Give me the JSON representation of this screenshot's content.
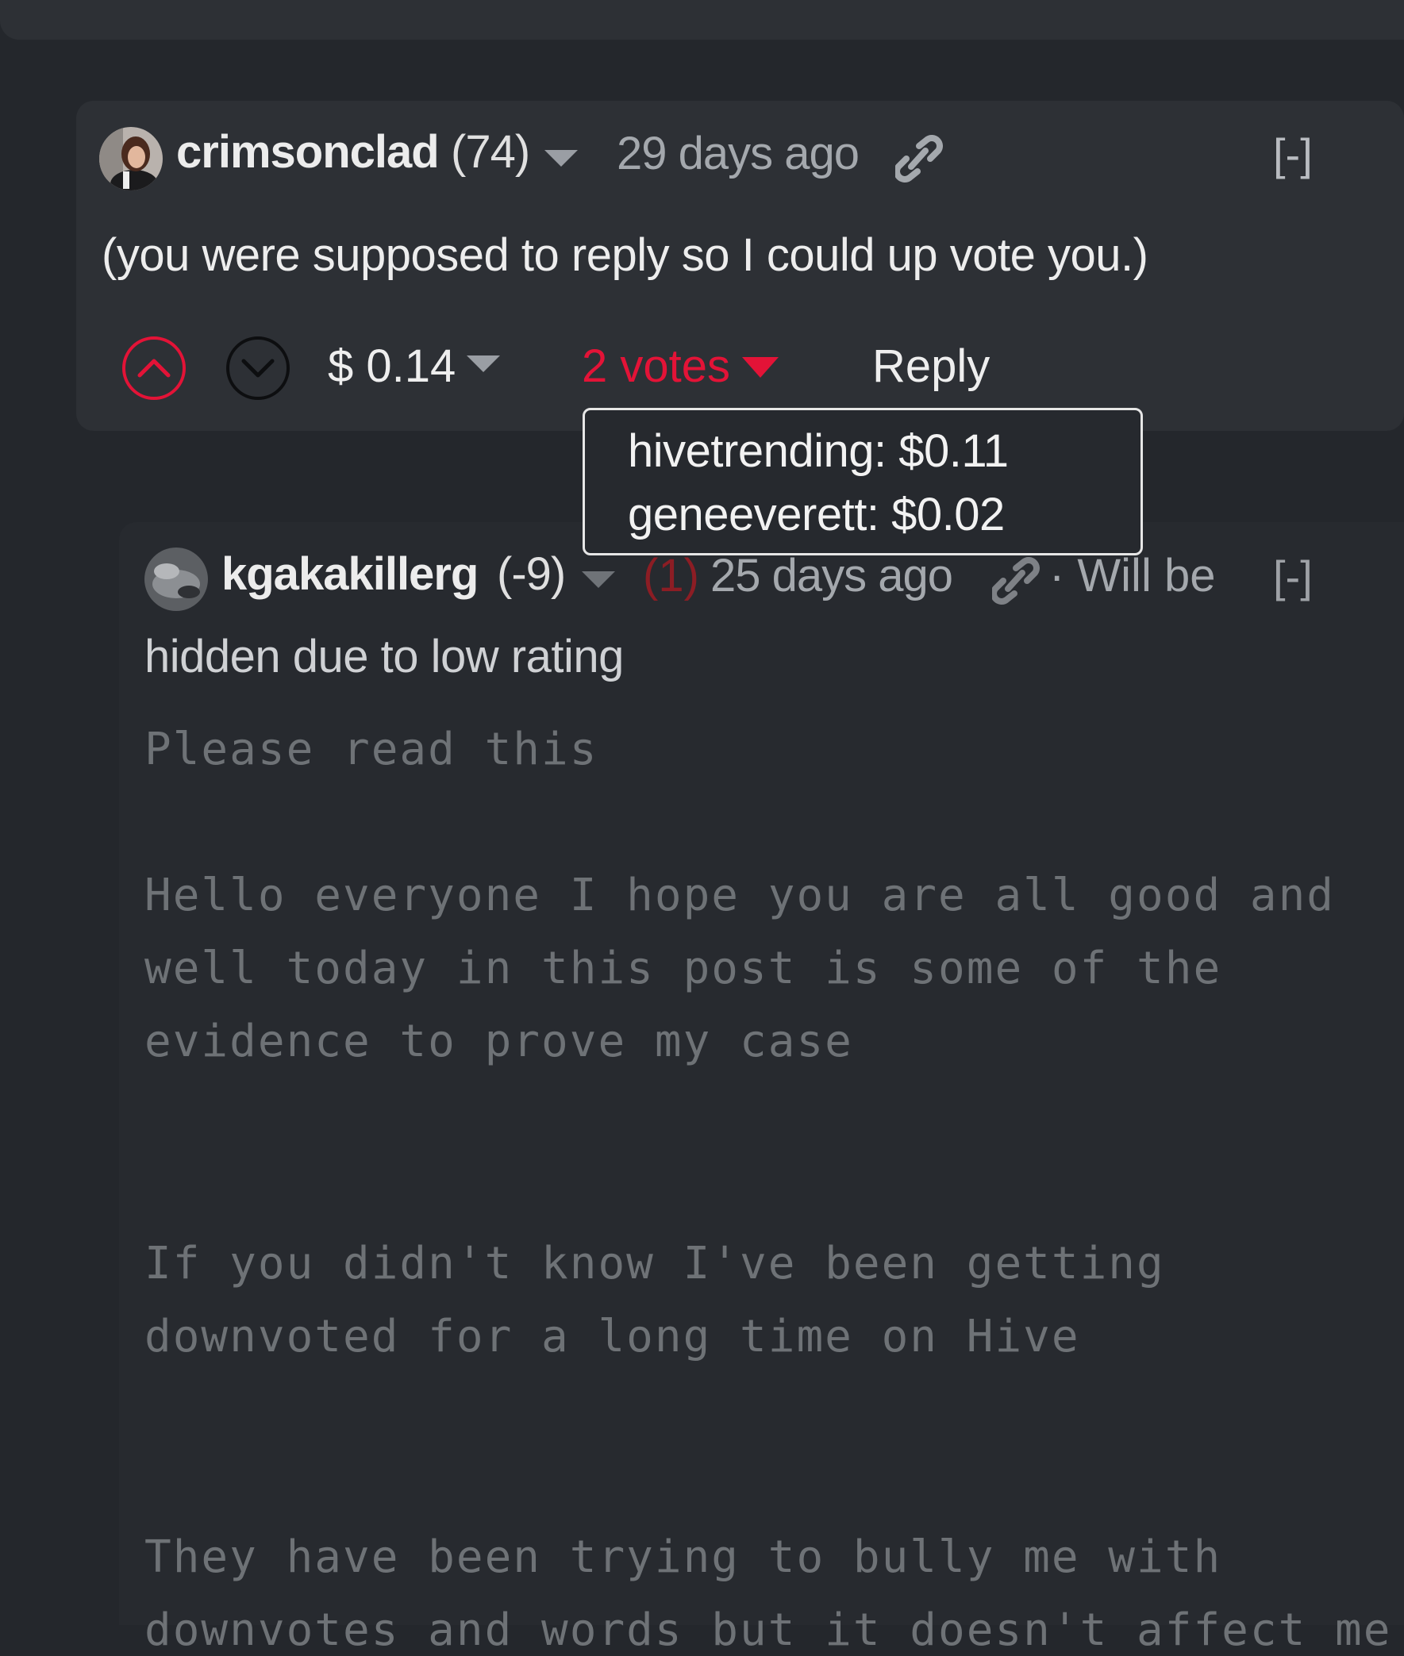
{
  "comment_parent": {
    "author": "crimsonclad",
    "reputation": "(74)",
    "timestamp": "29 days ago",
    "collapse": "[-]",
    "body": "(you were supposed to reply so I could up vote you.)",
    "payout": "$ 0.14",
    "votes": "2 votes",
    "reply": "Reply"
  },
  "voters_tooltip": {
    "lines": [
      "hivetrending: $0.11",
      "geneeverett: $0.02"
    ]
  },
  "comment_child": {
    "author": "kgakakillerg",
    "reputation": "(-9)",
    "negative_marker": "(1)",
    "timestamp": "25 days ago",
    "will_be": "· Will be",
    "collapse": "[-]",
    "hidden_note": "hidden due to low rating",
    "body_lines": [
      "Please read this",
      "Hello everyone I hope you are all good and",
      "well today in this post is some of the",
      "evidence to prove my case",
      "If you didn't know I've been getting",
      "downvoted for a long time on Hive",
      "They have been trying to bully me with",
      "downvotes and words but it doesn't affect me"
    ]
  },
  "colors": {
    "accent": "#e31337",
    "background": "#24272c",
    "card": "#2d3035"
  },
  "icons": [
    "link-icon",
    "upvote-icon",
    "downvote-icon",
    "chevron-down-icon"
  ]
}
